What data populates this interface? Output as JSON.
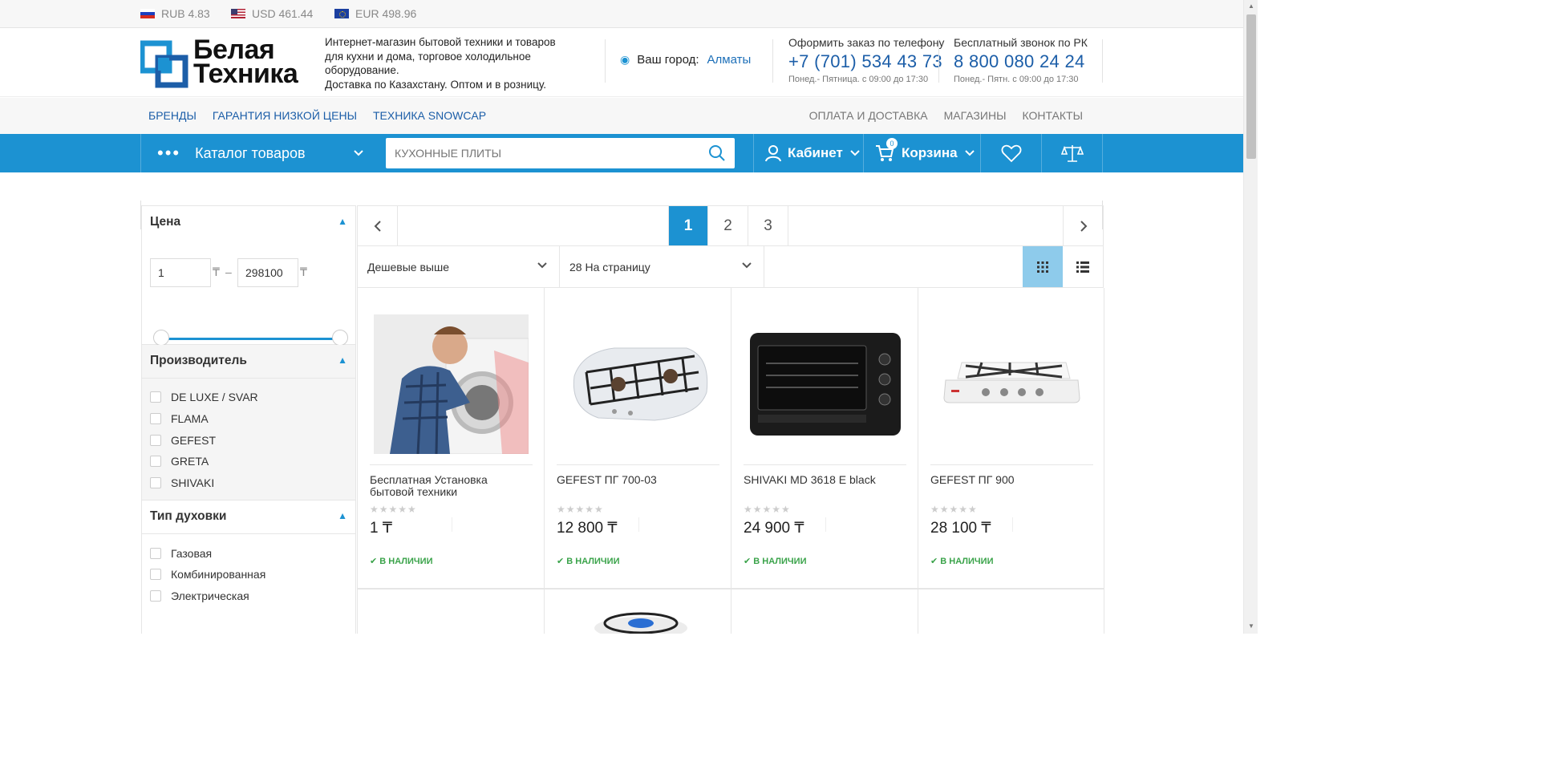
{
  "currencies": [
    {
      "flag": "ru",
      "label": "RUB 4.83"
    },
    {
      "flag": "us",
      "label": "USD 461.44"
    },
    {
      "flag": "eu",
      "label": "EUR 498.96"
    }
  ],
  "header": {
    "logo_line1": "Белая",
    "logo_line2": "Техника",
    "tagline": [
      "Интернет-магазин бытовой техники и товаров",
      "для кухни и дома, торговое холодильное оборудование.",
      "Доставка по Казахстану. Оптом и в розницу."
    ],
    "city_label": "Ваш город:",
    "city_value": "Алматы",
    "phone1": {
      "label": "Оформить заказ по телефону",
      "number": "+7 (701) 534 43 73",
      "hours": "Понед.- Пятница. с 09:00 до 17:30"
    },
    "phone2": {
      "label": "Бесплатный звонок по РК",
      "number": "8 800 080 24 24",
      "hours": "Понед.- Пятн. с 09:00 до 17:30"
    }
  },
  "nav": {
    "left": [
      "Бренды",
      "Гарантия низкой цены",
      "Техника Snowcap"
    ],
    "right": [
      "Оплата и доставка",
      "Магазины",
      "Контакты"
    ]
  },
  "bluebar": {
    "catalog": "Каталог товаров",
    "search_placeholder": "КУХОННЫЕ ПЛИТЫ",
    "cabinet": "Кабинет",
    "cart": "Корзина",
    "cart_count": "0",
    "accent": "#1c92d2"
  },
  "filters": {
    "price": {
      "title": "Цена",
      "min": "1",
      "max": "298100",
      "currency": "₸",
      "dash": "–"
    },
    "manufacturer": {
      "title": "Производитель",
      "items": [
        "DE LUXE / SVAR",
        "FLAMA",
        "GEFEST",
        "GRETA",
        "SHIVAKI"
      ]
    },
    "oven": {
      "title": "Тип духовки",
      "items": [
        "Газовая",
        "Комбинированная",
        "Электрическая"
      ]
    }
  },
  "pagination": {
    "pages": [
      "1",
      "2",
      "3"
    ],
    "active": "1"
  },
  "sort": {
    "order": "Дешевые выше",
    "per_page": "28 На страницу"
  },
  "products": [
    {
      "name": "Бесплатная Установка бытовой техники",
      "price": "1 ₸",
      "stock": "В наличии",
      "img": "technician-photo"
    },
    {
      "name": "GEFEST ПГ 700-03",
      "price": "12 800 ₸",
      "stock": "В наличии",
      "img": "gas-hob-2-burner"
    },
    {
      "name": "SHIVAKI MD 3618 E black",
      "price": "24 900 ₸",
      "stock": "В наличии",
      "img": "mini-oven"
    },
    {
      "name": "GEFEST ПГ 900",
      "price": "28 100 ₸",
      "stock": "В наличии",
      "img": "gas-hob-4-burner"
    }
  ],
  "stars": "★★★★★"
}
